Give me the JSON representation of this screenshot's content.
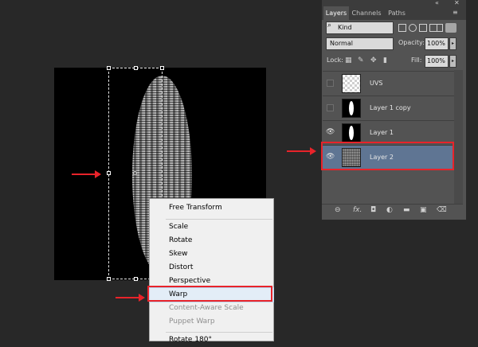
{
  "document": {
    "canvas_alt": ""
  },
  "context_menu": {
    "items": [
      {
        "label": "Free Transform",
        "enabled": true
      },
      {
        "label": "Scale",
        "enabled": true
      },
      {
        "label": "Rotate",
        "enabled": true
      },
      {
        "label": "Skew",
        "enabled": true
      },
      {
        "label": "Distort",
        "enabled": true
      },
      {
        "label": "Perspective",
        "enabled": true
      },
      {
        "label": "Warp",
        "enabled": true,
        "highlighted": true
      },
      {
        "label": "Content-Aware Scale",
        "enabled": false
      },
      {
        "label": "Puppet Warp",
        "enabled": false
      },
      {
        "label": "Rotate 180°",
        "enabled": true
      }
    ]
  },
  "layers_panel": {
    "tabs": [
      "Layers",
      "Channels",
      "Paths"
    ],
    "active_tab": "Layers",
    "filter": {
      "label": "Kind"
    },
    "blend_mode": "Normal",
    "opacity_label": "Opacity:",
    "opacity": "100%",
    "lock_label": "Lock:",
    "fill_label": "Fill:",
    "fill": "100%",
    "layers": [
      {
        "name": "UVS",
        "visible": false,
        "thumb": "checker"
      },
      {
        "name": "Layer 1 copy",
        "visible": false,
        "thumb": "black-white-ellipse"
      },
      {
        "name": "Layer 1",
        "visible": true,
        "thumb": "black-white-ellipse"
      },
      {
        "name": "Layer 2",
        "visible": true,
        "thumb": "noise",
        "selected": true
      }
    ],
    "footer_icons": [
      "link-icon",
      "fx-icon",
      "mask-icon",
      "adjustment-icon",
      "group-icon",
      "new-layer-icon",
      "trash-icon"
    ]
  },
  "annotations": {
    "color": "#e8232a"
  },
  "icons": {
    "eye": "👁",
    "search": "⌕",
    "collapse": "«",
    "close": "✕",
    "menu": "≡"
  }
}
